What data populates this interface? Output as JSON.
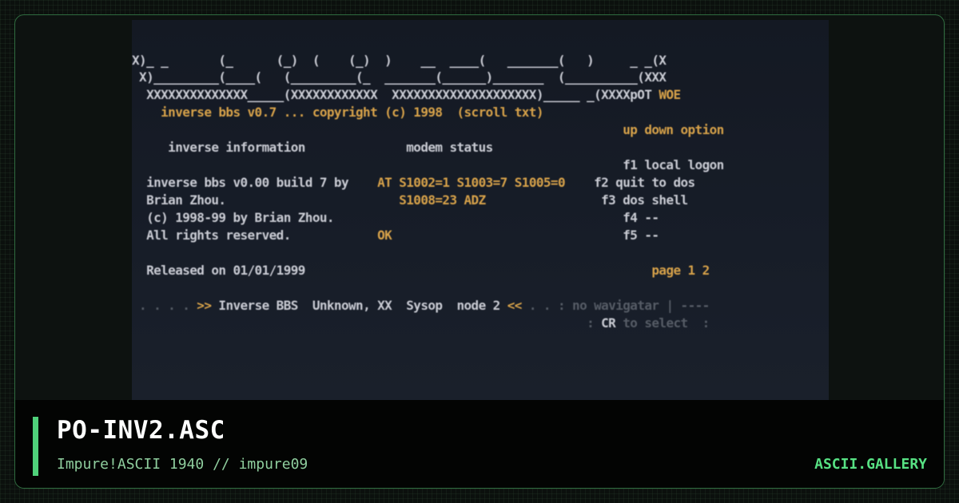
{
  "screen": {
    "lines": [
      {
        "segments": [
          {
            "t": "X)_ _       (_      (_)  (    (_)  )    __  ____(   _______(   )     _ _(X",
            "c": "w"
          }
        ]
      },
      {
        "segments": [
          {
            "t": " X)_________(____(   (_________(_  _______(______)_______  (__________(XXX",
            "c": "w"
          }
        ]
      },
      {
        "segments": [
          {
            "t": "  XXXXXXXXXXXXXX_____(XXXXXXXXXXXX  XXXXXXXXXXXXXXXXXXXX)_____ _(XXXXpOT ",
            "c": "w"
          },
          {
            "t": "WOE",
            "c": "o"
          }
        ]
      },
      {
        "segments": [
          {
            "t": "    inverse bbs v0.7 ... copyright (c) 1998  (scroll txt)",
            "c": "o"
          }
        ]
      },
      {
        "segments": [
          {
            "t": "                                                                    up down option",
            "c": "o"
          }
        ]
      },
      {
        "segments": [
          {
            "t": "     ",
            "c": "d"
          },
          {
            "t": "inverse information",
            "c": "w"
          },
          {
            "t": "              ",
            "c": "d"
          },
          {
            "t": "modem status",
            "c": "w"
          }
        ]
      },
      {
        "segments": [
          {
            "t": "                                                                    f1 local logon",
            "c": "w"
          }
        ]
      },
      {
        "segments": [
          {
            "t": "  inverse bbs v0.00 build 7 by    ",
            "c": "w"
          },
          {
            "t": "AT S1002=1 S1003=7 S1005=0",
            "c": "o"
          },
          {
            "t": "    f2 quit to dos",
            "c": "w"
          }
        ]
      },
      {
        "segments": [
          {
            "t": "  Brian Zhou.                        ",
            "c": "w"
          },
          {
            "t": "S1008=23 ADZ",
            "c": "o"
          },
          {
            "t": "                f3 dos shell",
            "c": "w"
          }
        ]
      },
      {
        "segments": [
          {
            "t": "  (c) 1998-99 by Brian Zhou.                                        f4 --",
            "c": "w"
          }
        ]
      },
      {
        "segments": [
          {
            "t": "  All rights reserved.            ",
            "c": "w"
          },
          {
            "t": "OK",
            "c": "o"
          },
          {
            "t": "                                f5 --",
            "c": "w"
          }
        ]
      },
      {
        "segments": [
          {
            "t": "",
            "c": "w"
          }
        ]
      },
      {
        "segments": [
          {
            "t": "  Released on 01/01/1999                                                ",
            "c": "w"
          },
          {
            "t": "page 1 2",
            "c": "o"
          }
        ]
      },
      {
        "segments": [
          {
            "t": "",
            "c": "w"
          }
        ]
      },
      {
        "segments": [
          {
            "t": " . . . . ",
            "c": "d"
          },
          {
            "t": ">>",
            "c": "o"
          },
          {
            "t": " Inverse BBS  Unknown, XX  Sysop  node 2 ",
            "c": "w"
          },
          {
            "t": "<<",
            "c": "o"
          },
          {
            "t": " . . : ",
            "c": "d"
          },
          {
            "t": "no wavigatar | ----",
            "c": "d"
          }
        ]
      },
      {
        "segments": [
          {
            "t": "                                                               : ",
            "c": "d"
          },
          {
            "t": "CR",
            "c": "w"
          },
          {
            "t": " to select  :",
            "c": "d"
          }
        ]
      }
    ]
  },
  "footer": {
    "title": "PO-INV2.ASC",
    "subtitle": "Impure!ASCII 1940 // impure09",
    "brand": "ASCII.GALLERY"
  },
  "colors": {
    "accent": "#4fd17a",
    "ansi_white": "#c9cbd3",
    "ansi_orange": "#d7a24a",
    "ansi_dim": "#565c66"
  }
}
